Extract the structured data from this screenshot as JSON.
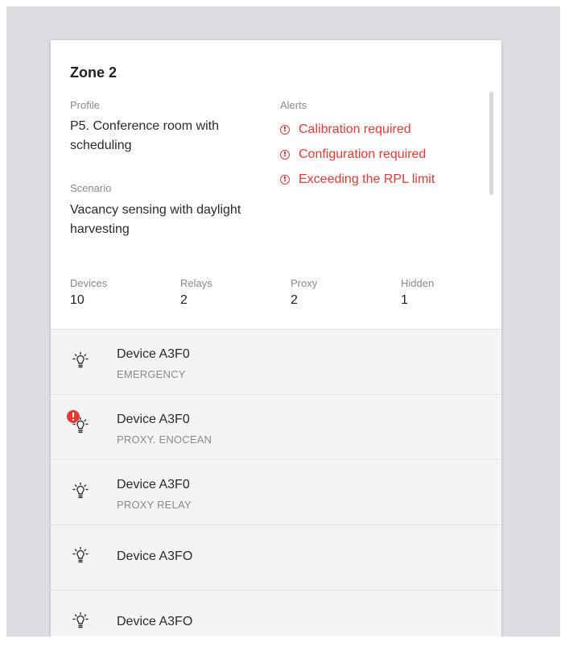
{
  "zone": {
    "title": "Zone 2",
    "profile_label": "Profile",
    "profile_value": "P5. Conference room with scheduling",
    "scenario_label": "Scenario",
    "scenario_value": "Vacancy sensing with daylight harvesting",
    "alerts_label": "Alerts",
    "alerts": [
      "Calibration required",
      "Configuration required",
      "Exceeding the RPL limit"
    ],
    "stats": [
      {
        "label": "Devices",
        "value": "10"
      },
      {
        "label": "Relays",
        "value": "2"
      },
      {
        "label": "Proxy",
        "value": "2"
      },
      {
        "label": "Hidden",
        "value": "1"
      }
    ]
  },
  "devices": [
    {
      "name": "Device A3F0",
      "subtitle": "EMERGENCY",
      "icon": "lightbulb-icon",
      "error": false
    },
    {
      "name": "Device A3F0",
      "subtitle": "PROXY. ENOCEAN",
      "icon": "lightbulb-icon",
      "error": true
    },
    {
      "name": "Device A3F0",
      "subtitle": "PROXY  RELAY",
      "icon": "lightbulb-icon",
      "error": false
    },
    {
      "name": "Device A3FO",
      "subtitle": "",
      "icon": "lightbulb-icon",
      "error": false
    },
    {
      "name": "Device A3FO",
      "subtitle": "",
      "icon": "lightbulb-icon",
      "error": false
    }
  ],
  "colors": {
    "alert": "#e53935",
    "background": "#dcdde0",
    "card": "#ffffff",
    "list_row": "#f4f4f4"
  }
}
